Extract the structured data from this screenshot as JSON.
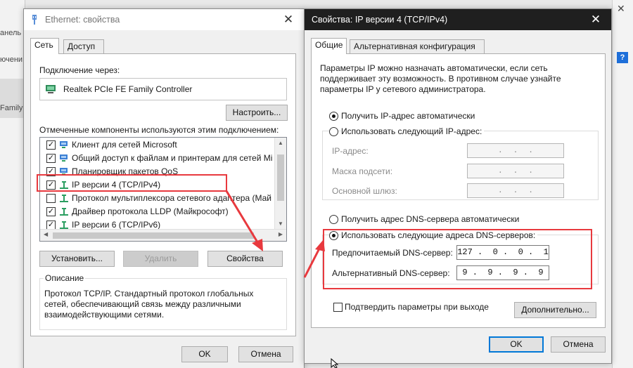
{
  "background_window": {
    "fragments": [
      "анель",
      "ючени",
      "Family"
    ]
  },
  "ethernet_dialog": {
    "title": "Ethernet: свойства",
    "tabs": [
      "Сеть",
      "Доступ"
    ],
    "connect_via_label": "Подключение через:",
    "adapter_name": "Realtek PCIe FE Family Controller",
    "configure_button": "Настроить...",
    "components_label": "Отмеченные компоненты используются этим подключением:",
    "components": [
      {
        "label": "Клиент для сетей Microsoft",
        "checked": true,
        "icon": "network-client-icon"
      },
      {
        "label": "Общий доступ к файлам и принтерам для сетей Mi",
        "checked": true,
        "icon": "network-client-icon"
      },
      {
        "label": "Планировщик пакетов QoS",
        "checked": true,
        "icon": "network-client-icon"
      },
      {
        "label": "IP версии 4 (TCP/IPv4)",
        "checked": true,
        "icon": "protocol-icon"
      },
      {
        "label": "Протокол мультиплексора сетевого адаптера (Май",
        "checked": false,
        "icon": "protocol-icon"
      },
      {
        "label": "Драйвер протокола LLDP (Майкрософт)",
        "checked": true,
        "icon": "protocol-icon"
      },
      {
        "label": "IP версии 6 (TCP/IPv6)",
        "checked": true,
        "icon": "protocol-icon"
      }
    ],
    "install_button": "Установить...",
    "remove_button": "Удалить",
    "properties_button": "Свойства",
    "description_label": "Описание",
    "description_text": [
      "Протокол TCP/IP. Стандартный протокол глобальных",
      "сетей, обеспечивающий связь между различными",
      "взаимодействующими сетями."
    ],
    "ok_button": "OK",
    "cancel_button": "Отмена"
  },
  "ipv4_dialog": {
    "title": "Свойства: IP версии 4 (TCP/IPv4)",
    "tabs": [
      "Общие",
      "Альтернативная конфигурация"
    ],
    "intro_text": [
      "Параметры IP можно назначать автоматически, если сеть",
      "поддерживает эту возможность. В противном случае узнайте",
      "параметры IP у сетевого администратора."
    ],
    "ip_auto_radio": "Получить IP-адрес автоматически",
    "ip_manual_radio": "Использовать следующий IP-адрес:",
    "ip_address_label": "IP-адрес:",
    "subnet_label": "Маска подсети:",
    "gateway_label": "Основной шлюз:",
    "empty_ip": " .  .  . ",
    "dns_auto_radio": "Получить адрес DNS-сервера автоматически",
    "dns_manual_radio": "Использовать следующие адреса DNS-серверов:",
    "preferred_dns_label": "Предпочитаемый DNS-сервер:",
    "preferred_dns_value": "127 .  0 .  0 .  1",
    "alternate_dns_label": "Альтернативный DNS-сервер:",
    "alternate_dns_value": "9 .  9 .  9 .  9",
    "validate_checkbox": "Подтвердить параметры при выходе",
    "advanced_button": "Дополнительно...",
    "ok_button": "OK",
    "cancel_button": "Отмена"
  },
  "colors": {
    "annotation_red": "#e8393e",
    "focus_blue": "#0078d7"
  }
}
